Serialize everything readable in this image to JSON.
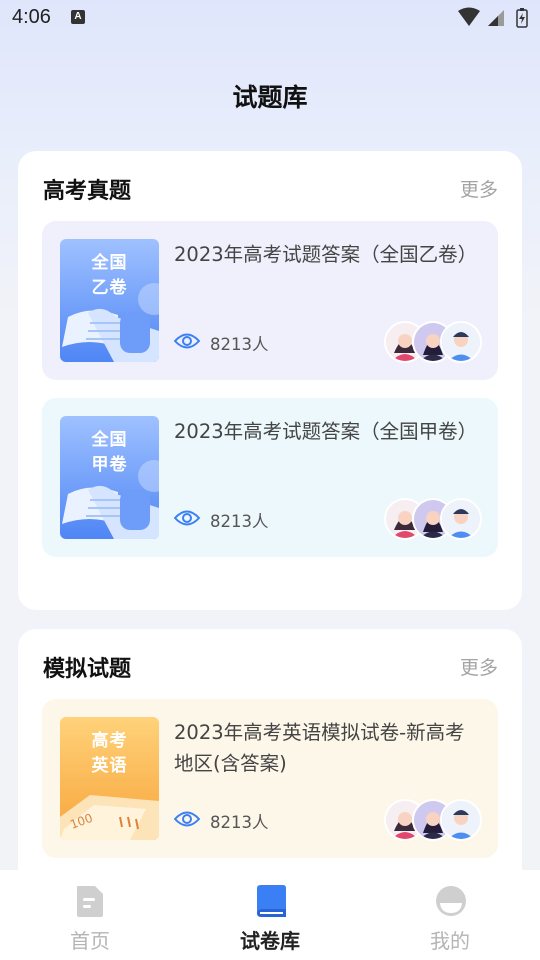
{
  "status": {
    "time": "4:06",
    "badge": "A"
  },
  "header": {
    "title": "试题库"
  },
  "sections": [
    {
      "title": "高考真题",
      "more": "更多",
      "items": [
        {
          "thumb": [
            "全国",
            "乙卷"
          ],
          "title": "2023年高考试题答案（全国乙卷）",
          "count": "8213人"
        },
        {
          "thumb": [
            "全国",
            "甲卷"
          ],
          "title": "2023年高考试题答案（全国甲卷）",
          "count": "8213人"
        }
      ]
    },
    {
      "title": "模拟试题",
      "more": "更多",
      "items": [
        {
          "thumb": [
            "高考",
            "英语"
          ],
          "title": "2023年高考英语模拟试卷-新高考地区(含答案)",
          "count": "8213人"
        }
      ]
    }
  ],
  "tabs": [
    {
      "label": "首页",
      "icon": "document-icon",
      "active": false
    },
    {
      "label": "试卷库",
      "icon": "book-icon",
      "active": true
    },
    {
      "label": "我的",
      "icon": "profile-icon",
      "active": false
    }
  ],
  "colors": {
    "accent": "#3b7ff5",
    "item_bg_1": "#f0f0fd",
    "item_bg_2": "#ecf8fc",
    "item_bg_3": "#fdf7ea",
    "more_text": "#a4a4a4"
  }
}
